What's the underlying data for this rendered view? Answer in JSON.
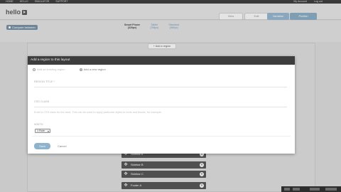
{
  "adminbar": {
    "nav": [
      "HOME",
      "HELLO",
      "SIMULATOR",
      "SUPPORT"
    ],
    "right": [
      "My Account",
      "Log out"
    ]
  },
  "header": {
    "logo": "hello",
    "view_tabs": [
      "View",
      "Edit",
      "Variation"
    ],
    "buttons": [
      "Variation",
      "Publish"
    ]
  },
  "toolbar": {
    "compare_label": "Compare between",
    "devices": [
      {
        "name": "Smart Phone",
        "size": "(320px)"
      },
      {
        "name": "Tablet",
        "size": "(768px)"
      },
      {
        "name": "Standard",
        "size": "(960px)"
      }
    ]
  },
  "canvas": {
    "add_region_label": "+ Add a region",
    "regions": [
      "Sidebar A",
      "Sidebar B",
      "Sidebar C",
      "Footer A"
    ]
  },
  "modal": {
    "title": "Add a region to this layout",
    "radio_options": [
      "Add an existing region",
      "Add a new region"
    ],
    "selected_radio": 1,
    "field_region_name": "REGION TITLE *",
    "field_css_class": "CSS CLASS",
    "css_hint": "Enter a CSS class for the area. This can be used to apply particular styles to fonts and blocks, for example.",
    "width_label": "WIDTH",
    "width_value": "1 Rule",
    "save_label": "Save",
    "cancel_label": "Cancel"
  },
  "colors": {
    "accent": "#8fb3cc",
    "modal_header": "#3d3d3d",
    "region_bar": "#505050"
  }
}
